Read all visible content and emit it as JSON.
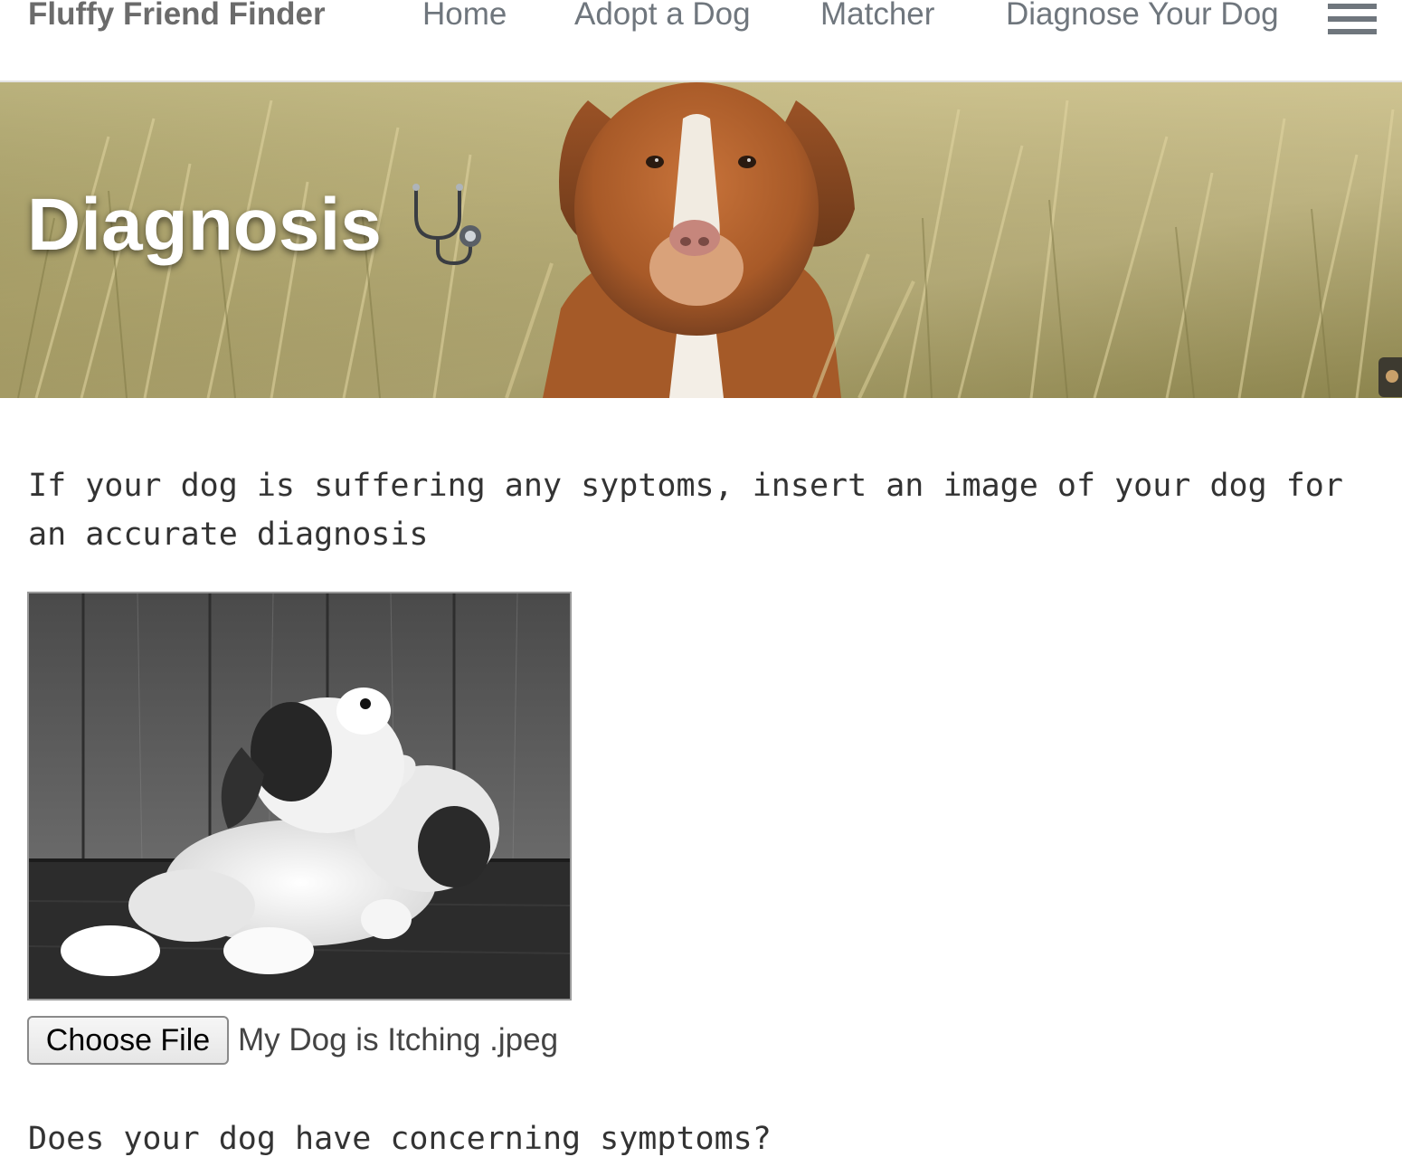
{
  "navbar": {
    "brand": "Fluffy Friend Finder",
    "links": [
      "Home",
      "Adopt a Dog",
      "Matcher",
      "Diagnose Your Dog"
    ],
    "menu_icon": "hamburger-menu-icon",
    "text_color": "#6f767d"
  },
  "hero": {
    "title": "Diagnosis",
    "title_icon": "stethoscope-icon",
    "background": "dog-in-wheat-field-photo",
    "title_color": "#ffffff"
  },
  "content": {
    "intro": "If your dog is suffering any syptoms, insert an image of your dog for an accurate diagnosis",
    "preview_image": "itching-puppy-photo",
    "file_input": {
      "button_label": "Choose File",
      "file_name": "My Dog is Itching .jpeg"
    },
    "question": "Does your dog have concerning symptoms?"
  }
}
